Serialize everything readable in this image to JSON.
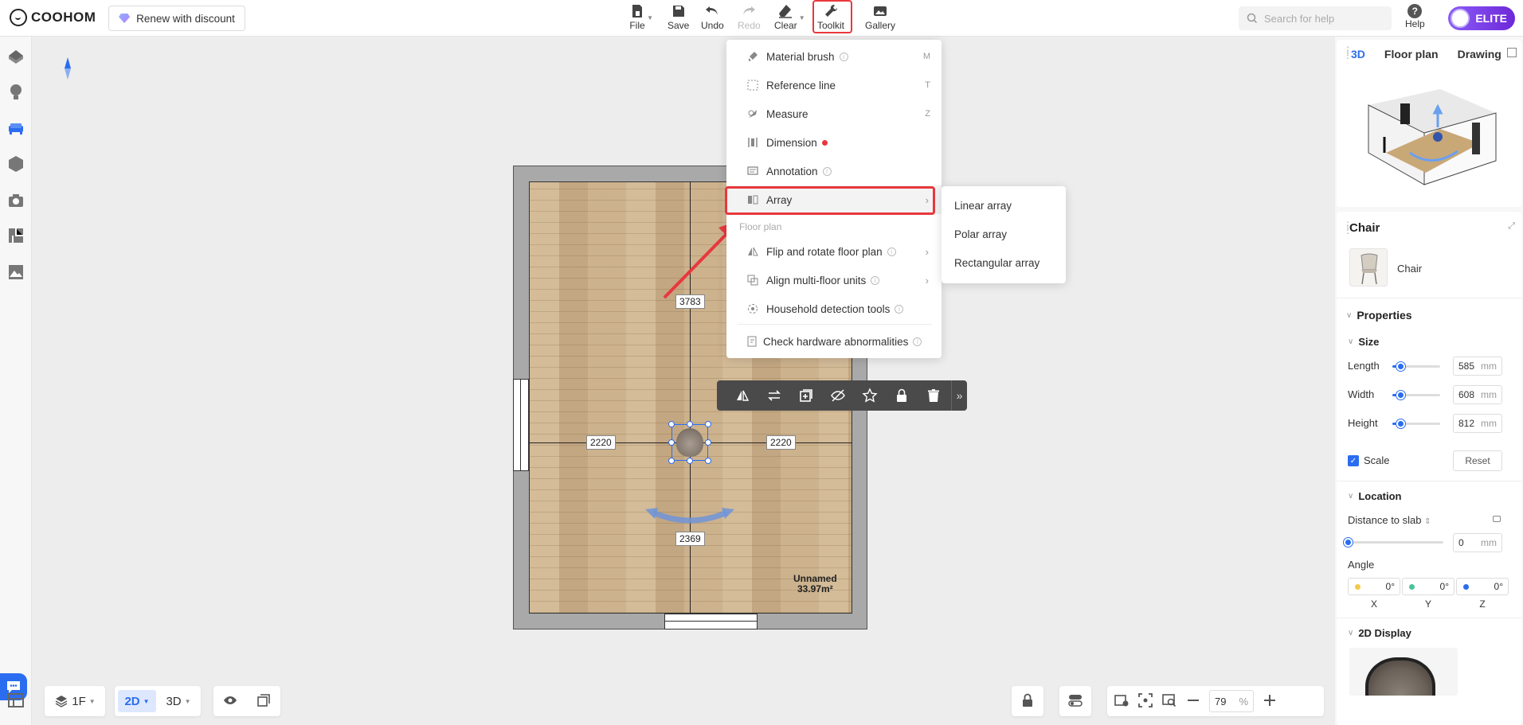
{
  "topbar": {
    "logo_text": "COOHOM",
    "renew_label": "Renew with discount",
    "tools": [
      {
        "label": "File"
      },
      {
        "label": "Save"
      },
      {
        "label": "Undo"
      },
      {
        "label": "Redo"
      },
      {
        "label": "Clear"
      },
      {
        "label": "Toolkit"
      },
      {
        "label": "Gallery"
      }
    ],
    "search_placeholder": "Search for help",
    "help_label": "Help",
    "elite_label": "ELITE"
  },
  "toolkit_menu": {
    "items": [
      {
        "label": "Material brush",
        "shortcut": "M"
      },
      {
        "label": "Reference line",
        "shortcut": "T"
      },
      {
        "label": "Measure",
        "shortcut": "Z"
      },
      {
        "label": "Dimension"
      },
      {
        "label": "Annotation"
      },
      {
        "label": "Array"
      }
    ],
    "section_label": "Floor plan",
    "floor_items": [
      {
        "label": "Flip and rotate floor plan"
      },
      {
        "label": "Align multi-floor units"
      },
      {
        "label": "Household detection tools"
      }
    ],
    "check_label": "Check hardware abnormalities"
  },
  "array_submenu": {
    "items": [
      {
        "label": "Linear array"
      },
      {
        "label": "Polar array"
      },
      {
        "label": "Rectangular array"
      }
    ]
  },
  "canvas": {
    "dim_top": "3783",
    "dim_left": "2220",
    "dim_right": "2220",
    "dim_bottom": "2369",
    "room_name": "Unnamed",
    "room_area": "33.97m²"
  },
  "bottom": {
    "floor_label": "1F",
    "mode_2d": "2D",
    "mode_3d": "3D",
    "zoom_value": "79",
    "zoom_unit": "%"
  },
  "rightpanel": {
    "view_tabs": [
      "3D",
      "Floor plan",
      "Drawing"
    ],
    "title": "Chair",
    "item_name": "Chair",
    "properties_label": "Properties",
    "size_label": "Size",
    "length_label": "Length",
    "length_value": "585",
    "width_label": "Width",
    "width_value": "608",
    "height_label": "Height",
    "height_value": "812",
    "unit": "mm",
    "scale_label": "Scale",
    "reset_label": "Reset",
    "location_label": "Location",
    "distance_label": "Distance to slab",
    "distance_value": "0",
    "angle_label": "Angle",
    "angle_x": "0°",
    "angle_y": "0°",
    "angle_z": "0°",
    "axis_x": "X",
    "axis_y": "Y",
    "axis_z": "Z",
    "display_label": "2D Display"
  },
  "colors": {
    "accent": "#2b6df0",
    "highlight_red": "#e8383d",
    "elite_purple": "#7c3aed"
  }
}
